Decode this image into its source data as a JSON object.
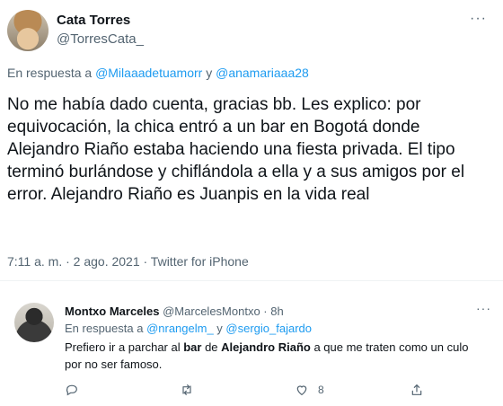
{
  "tweet": {
    "display_name": "Cata Torres",
    "handle": "@TorresCata_",
    "reply_prefix": "En respuesta a ",
    "reply_user_1": "@Milaaadetuamorr",
    "reply_and": " y ",
    "reply_user_2": "@anamariaaa28",
    "text": "No me había dado cuenta, gracias bb. Les explico: por equivocación, la chica entró a un bar en Bogotá donde Alejandro Riaño estaba haciendo una fiesta privada. El tipo terminó burlándose y chiflándola a ella y a sus amigos por el error. Alejandro Riaño es Juanpis en la vida real",
    "timestamp": "7:11 a. m. · 2 ago. 2021 · Twitter for iPhone",
    "more_glyph": "···"
  },
  "reply": {
    "display_name": "Montxo Marceles",
    "handle_time": "@MarcelesMontxo · 8h",
    "reply_prefix": "En respuesta a ",
    "reply_user_1": "@nrangelm_",
    "reply_and": " y ",
    "reply_user_2": "@sergio_fajardo",
    "text_1": "Prefiero ir a parchar al ",
    "text_bold_1": "bar",
    "text_2": " de ",
    "text_bold_2": "Alejandro Riaño",
    "text_3": " a que me traten como un culo por no ser famoso.",
    "more_glyph": "···",
    "actions": {
      "reply_icon": "comment-icon",
      "retweet_icon": "retweet-icon",
      "like_icon": "heart-icon",
      "like_count": "8",
      "share_icon": "share-icon"
    }
  },
  "colors": {
    "text": "#0f1419",
    "secondary": "#536471",
    "link": "#1d9bf0",
    "divider": "#eff3f4"
  }
}
